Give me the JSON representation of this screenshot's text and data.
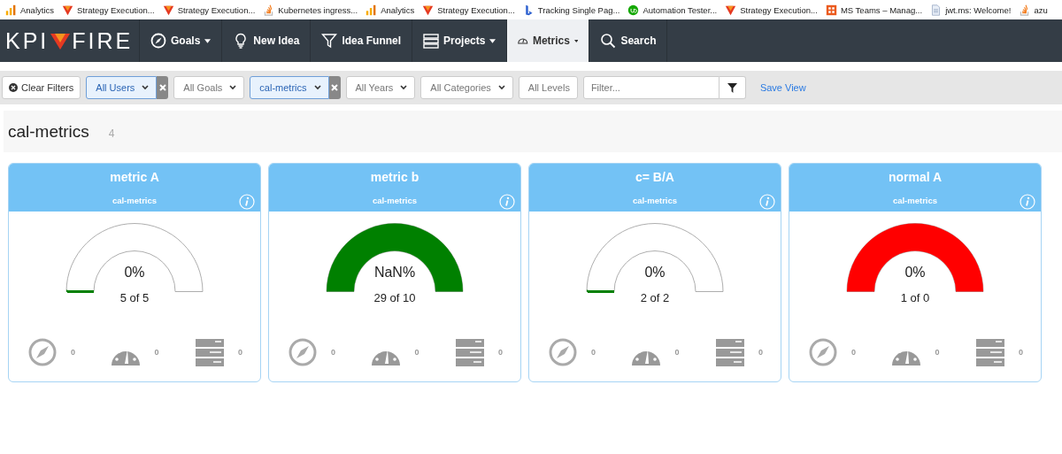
{
  "bookmarks": [
    {
      "kind": "analytics",
      "label": "Analytics"
    },
    {
      "kind": "kpifire",
      "label": "Strategy Execution..."
    },
    {
      "kind": "kpifire",
      "label": "Strategy Execution..."
    },
    {
      "kind": "stack",
      "label": "Kubernetes ingress..."
    },
    {
      "kind": "analytics",
      "label": "Analytics"
    },
    {
      "kind": "kpifire",
      "label": "Strategy Execution..."
    },
    {
      "kind": "bing",
      "label": "Tracking Single Pag..."
    },
    {
      "kind": "upwork",
      "label": "Automation Tester..."
    },
    {
      "kind": "kpifire",
      "label": "Strategy Execution..."
    },
    {
      "kind": "office",
      "label": "MS Teams – Manag..."
    },
    {
      "kind": "doc",
      "label": "jwt.ms: Welcome!"
    },
    {
      "kind": "stack",
      "label": "azu"
    }
  ],
  "nav": {
    "logo_left": "KPI",
    "logo_right": "FIRE",
    "items": [
      {
        "kind": "compass",
        "label": "Goals",
        "dropdown": true,
        "selected": false
      },
      {
        "kind": "bulb",
        "label": "New Idea",
        "dropdown": false,
        "selected": false
      },
      {
        "kind": "funnel",
        "label": "Idea Funnel",
        "dropdown": false,
        "selected": false
      },
      {
        "kind": "projects",
        "label": "Projects",
        "dropdown": true,
        "selected": false
      },
      {
        "kind": "gauge",
        "label": "Metrics",
        "dropdown": true,
        "selected": true
      },
      {
        "kind": "search",
        "label": "Search",
        "dropdown": false,
        "selected": false
      }
    ]
  },
  "filters": {
    "clear": "Clear Filters",
    "selects": [
      {
        "kind": "select",
        "value": "All Users",
        "active": true
      },
      {
        "kind": "select",
        "value": "All Goals",
        "active": false
      },
      {
        "kind": "select",
        "value": "cal-metrics",
        "active": true
      },
      {
        "kind": "select",
        "value": "All Years",
        "active": false
      },
      {
        "kind": "select",
        "value": "All Categories",
        "active": false
      },
      {
        "kind": "plain",
        "value": "All Levels",
        "active": false
      }
    ],
    "search": {
      "placeholder": "Filter..."
    },
    "save": "Save View"
  },
  "group": {
    "title": "cal-metrics",
    "count": "4"
  },
  "cards": [
    {
      "title": "metric A",
      "subtitle": "cal-metrics",
      "percent": "0%",
      "progress": "5 of 5",
      "gauge": {
        "level": 0,
        "color": "#008000"
      },
      "stats": [
        {
          "kind": "goals",
          "count": "0"
        },
        {
          "kind": "metrics",
          "count": "0"
        },
        {
          "kind": "projects",
          "count": "0"
        }
      ]
    },
    {
      "title": "metric b",
      "subtitle": "cal-metrics",
      "percent": "NaN%",
      "progress": "29 of 10",
      "gauge": {
        "level": 1,
        "color": "#008000"
      },
      "stats": [
        {
          "kind": "goals",
          "count": "0"
        },
        {
          "kind": "metrics",
          "count": "0"
        },
        {
          "kind": "projects",
          "count": "0"
        }
      ]
    },
    {
      "title": "c= B/A",
      "subtitle": "cal-metrics",
      "percent": "0%",
      "progress": "2 of 2",
      "gauge": {
        "level": 0,
        "color": "#008000"
      },
      "stats": [
        {
          "kind": "goals",
          "count": "0"
        },
        {
          "kind": "metrics",
          "count": "0"
        },
        {
          "kind": "projects",
          "count": "0"
        }
      ]
    },
    {
      "title": "normal A",
      "subtitle": "cal-metrics",
      "percent": "0%",
      "progress": "1 of 0",
      "gauge": {
        "level": 1,
        "color": "#ff0000"
      },
      "stats": [
        {
          "kind": "goals",
          "count": "0"
        },
        {
          "kind": "metrics",
          "count": "0"
        },
        {
          "kind": "projects",
          "count": "0"
        }
      ]
    }
  ]
}
